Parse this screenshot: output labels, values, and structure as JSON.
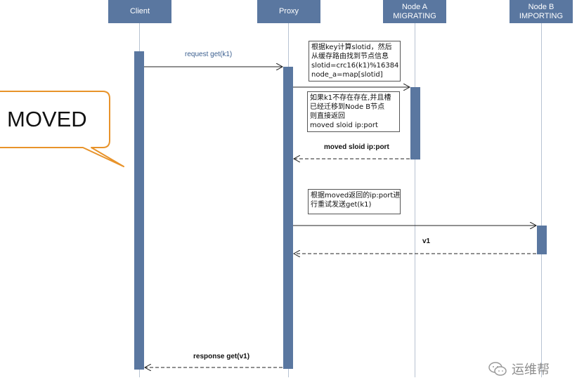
{
  "participants": [
    {
      "id": "client",
      "label": "Client",
      "sub": ""
    },
    {
      "id": "proxy",
      "label": "Proxy",
      "sub": ""
    },
    {
      "id": "nodeA",
      "label": "Node A",
      "sub": "MIGRATING"
    },
    {
      "id": "nodeB",
      "label": "Node B",
      "sub": "IMPORTING"
    }
  ],
  "messages": {
    "request": "request get(k1)",
    "moved": "moved  sloid ip:port",
    "v1": "v1",
    "response": "response get(v1)"
  },
  "notes": {
    "compute_slot": [
      "根据key计算slotid，然后",
      "从缓存路由找到节点信息",
      "slotid=crc16(k1)%16384",
      "node_a=map[slotid]"
    ],
    "not_exist": [
      "如果k1不存在存在,并且槽",
      "已经迁移到Node B节点",
      "则直接返回",
      "moved  sloid ip:port"
    ],
    "retry": [
      "根据moved返回的ip:port进",
      "行重试发送get(k1)"
    ]
  },
  "callout": {
    "text": "MOVED"
  },
  "watermark": {
    "text": "运维帮"
  },
  "colors": {
    "box": "#5a77a0",
    "callout_border": "#e8932a",
    "arrow": "#222222"
  }
}
